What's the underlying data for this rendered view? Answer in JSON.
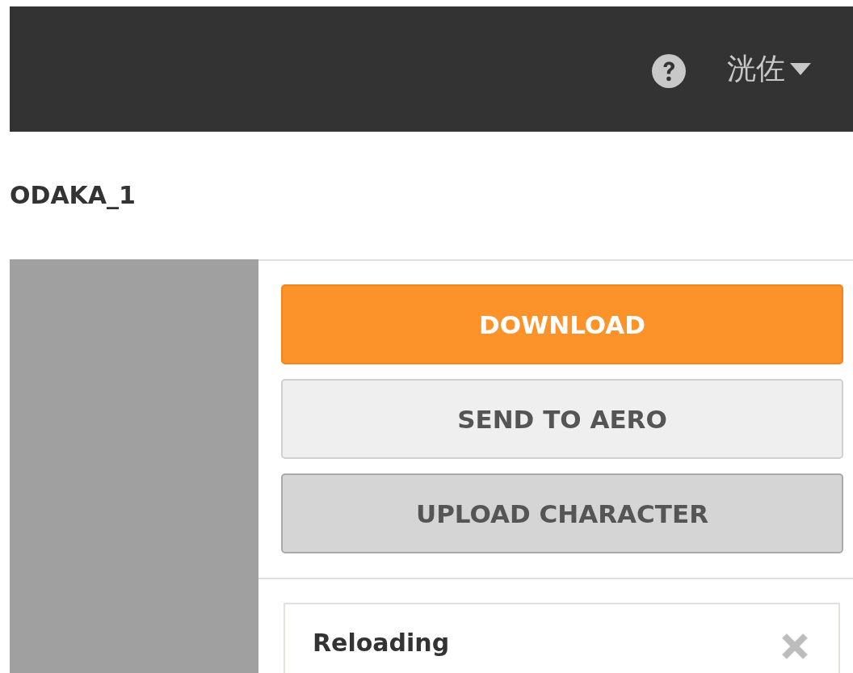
{
  "header": {
    "user_menu": {
      "label": "洸佐"
    }
  },
  "page_title": "ODAKA_1",
  "actions": [
    {
      "label": "DOWNLOAD",
      "kind": "primary"
    },
    {
      "label": "SEND TO AERO",
      "kind": "secondary"
    },
    {
      "label": "UPLOAD CHARACTER",
      "kind": "tertiary"
    }
  ],
  "notice": {
    "title": "Reloading"
  }
}
